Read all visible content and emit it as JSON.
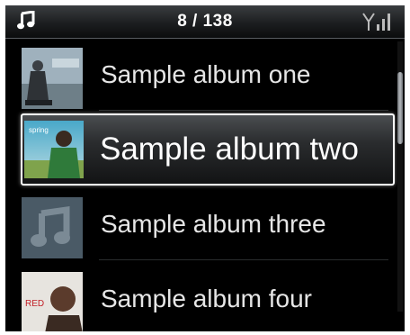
{
  "status_bar": {
    "position_text": "8 / 138",
    "left_icon": "music-note-icon",
    "right_icon": "signal-strength-icon"
  },
  "albums": [
    {
      "title": "Sample album one",
      "art": "album-art-beach-figure",
      "selected": false
    },
    {
      "title": "Sample album two",
      "art": "album-art-man-green-jacket",
      "selected": true
    },
    {
      "title": "Sample album three",
      "art": "album-art-placeholder-note",
      "selected": false
    },
    {
      "title": "Sample album four",
      "art": "album-art-woman-red-text",
      "selected": false
    }
  ],
  "cover_text": {
    "album_two_small": "spring",
    "album_four_small": "RED"
  },
  "colors": {
    "background": "#000000",
    "highlight_border": "#ffffff",
    "text": "#e6e6e6"
  }
}
